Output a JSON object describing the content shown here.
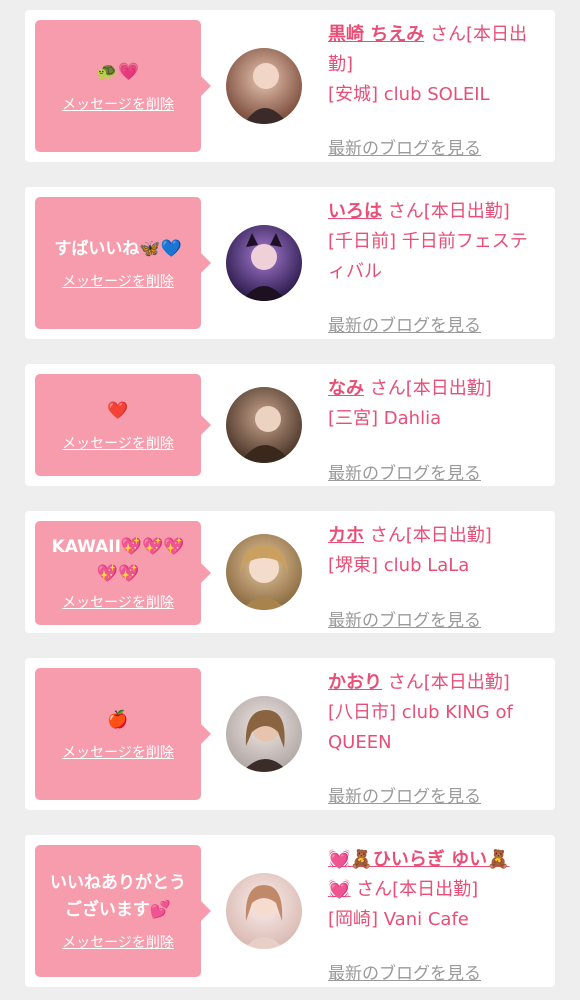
{
  "cards": [
    {
      "message": "🐢💗",
      "delete_label": "メッセージを削除",
      "name": "黒崎 ちえみ",
      "suffix": " さん[本日出勤]",
      "shop": "[安城] club SOLEIL",
      "blog_label": "最新のブログを見る"
    },
    {
      "message": "すばいいね🦋💙",
      "delete_label": "メッセージを削除",
      "name": "いろは",
      "suffix": " さん[本日出勤]",
      "shop": "[千日前] 千日前フェスティバル",
      "blog_label": "最新のブログを見る"
    },
    {
      "message": "❤️",
      "delete_label": "メッセージを削除",
      "name": "なみ",
      "suffix": " さん[本日出勤]",
      "shop": "[三宮] Dahlia",
      "blog_label": "最新のブログを見る"
    },
    {
      "message": "KAWAII💖💖💖\n💖💖",
      "delete_label": "メッセージを削除",
      "name": "カホ",
      "suffix": " さん[本日出勤]",
      "shop": "[堺東] club LaLa",
      "blog_label": "最新のブログを見る"
    },
    {
      "message": "🍎",
      "delete_label": "メッセージを削除",
      "name": "かおり",
      "suffix": " さん[本日出勤]",
      "shop": "[八日市] club KING of QUEEN",
      "blog_label": "最新のブログを見る"
    },
    {
      "message": "いいねありがとう\nございます💕",
      "delete_label": "メッセージを削除",
      "name": "💓🧸ひいらぎ ゆい🧸\n💓",
      "suffix": " さん[本日出勤]",
      "shop": "[岡崎] Vani Cafe",
      "blog_label": "最新のブログを見る"
    }
  ],
  "colors": {
    "accent": "#e94e77",
    "bubble": "#f79cac",
    "link_gray": "#9a9a9a",
    "background": "#eeeeee"
  }
}
